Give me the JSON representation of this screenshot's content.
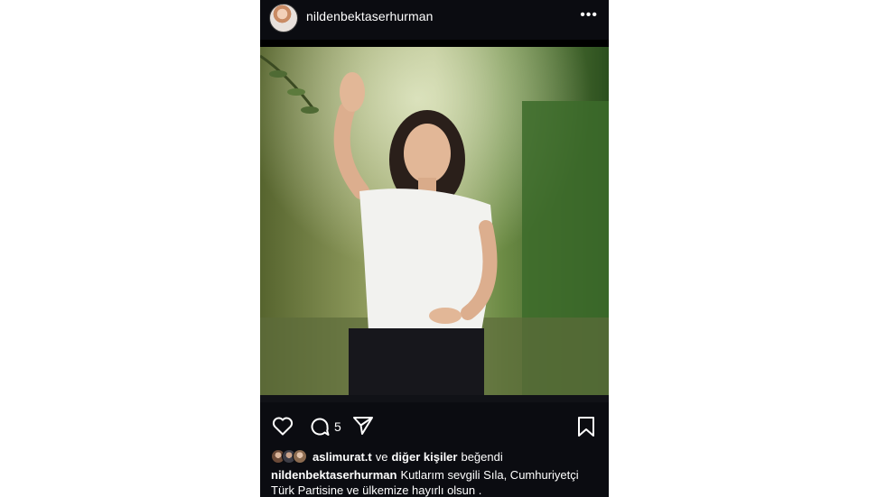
{
  "post": {
    "username": "nildenbektaserhurman",
    "more_label": "•••"
  },
  "actions": {
    "comment_count": "5"
  },
  "likes": {
    "first_liker": "aslimurat.t",
    "connector": "ve",
    "others": "diğer kişiler",
    "suffix": "beğendi"
  },
  "caption": {
    "author": "nildenbektaserhurman",
    "text": "Kutlarım sevgili Sıla, Cumhuriyetçi Türk Partisine ve ülkemize hayırlı olsun ."
  },
  "colors": {
    "background": "#000000",
    "bar": "#0b0c11",
    "text": "#ffffff"
  },
  "icons": [
    "heart-icon",
    "comment-icon",
    "share-icon",
    "bookmark-icon",
    "more-icon"
  ]
}
